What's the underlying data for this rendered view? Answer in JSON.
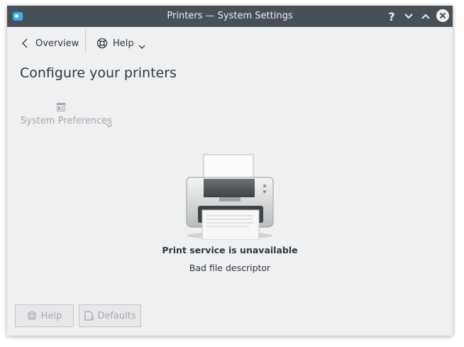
{
  "window": {
    "title": "Printers — System Settings"
  },
  "titlebar": {
    "icons": [
      "app-icon",
      "help-icon",
      "minimize-icon",
      "maximize-icon",
      "close-icon"
    ]
  },
  "toolbar": {
    "overview_label": "Overview",
    "help_label": "Help"
  },
  "page": {
    "title": "Configure your printers",
    "system_preferences_label": "System Preferences"
  },
  "status": {
    "title": "Print service is unavailable",
    "message": "Bad file descriptor"
  },
  "footer": {
    "help_label": "Help",
    "defaults_label": "Defaults"
  }
}
